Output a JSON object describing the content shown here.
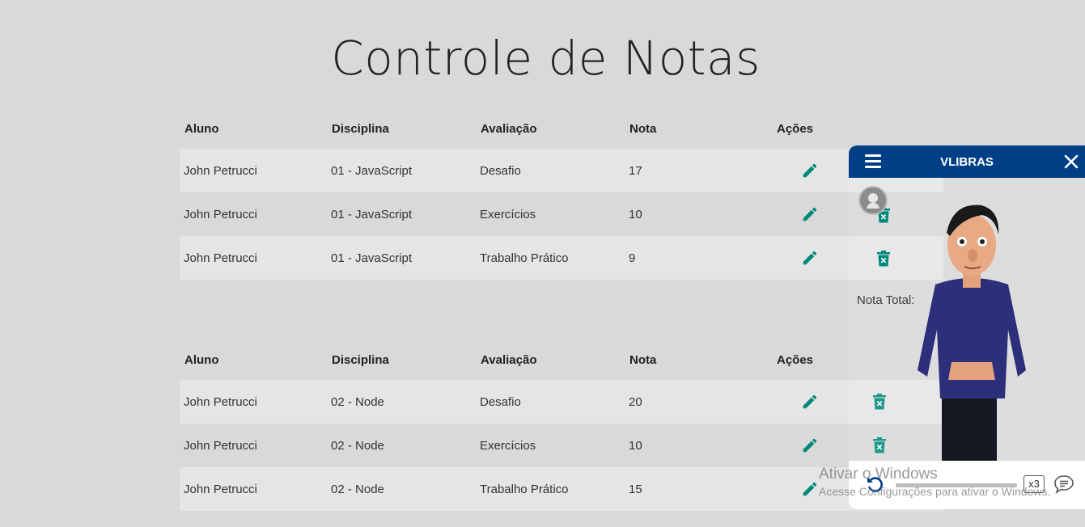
{
  "page": {
    "title": "Controle de Notas"
  },
  "columns": [
    "Aluno",
    "Disciplina",
    "Avaliação",
    "Nota",
    "Ações"
  ],
  "tables": [
    {
      "rows": [
        {
          "aluno": "John Petrucci",
          "disciplina": "01 - JavaScript",
          "avaliacao": "Desafio",
          "nota": "17"
        },
        {
          "aluno": "John Petrucci",
          "disciplina": "01 - JavaScript",
          "avaliacao": "Exercícios",
          "nota": "10"
        },
        {
          "aluno": "John Petrucci",
          "disciplina": "01 - JavaScript",
          "avaliacao": "Trabalho Prático",
          "nota": "9"
        }
      ]
    },
    {
      "rows": [
        {
          "aluno": "John Petrucci",
          "disciplina": "02 - Node",
          "avaliacao": "Desafio",
          "nota": "20"
        },
        {
          "aluno": "John Petrucci",
          "disciplina": "02 - Node",
          "avaliacao": "Exercícios",
          "nota": "10"
        },
        {
          "aluno": "John Petrucci",
          "disciplina": "02 - Node",
          "avaliacao": "Trabalho Prático",
          "nota": "15"
        }
      ]
    }
  ],
  "total": {
    "label": "Nota Total:"
  },
  "vlibras": {
    "title": "VLIBRAS",
    "speed": "x3",
    "icons": {
      "menu": "hamburger-menu-icon",
      "close": "close-icon",
      "replay": "replay-icon",
      "subtitle": "speech-bubble-icon"
    },
    "header_color": "#003f86"
  },
  "actions": {
    "edit_icon": "pencil-icon",
    "delete_icon": "trash-icon",
    "icon_color": "#00897b"
  },
  "watermark": {
    "title": "Ativar o Windows",
    "subtitle": "Acesse Configurações para ativar o Windows."
  }
}
